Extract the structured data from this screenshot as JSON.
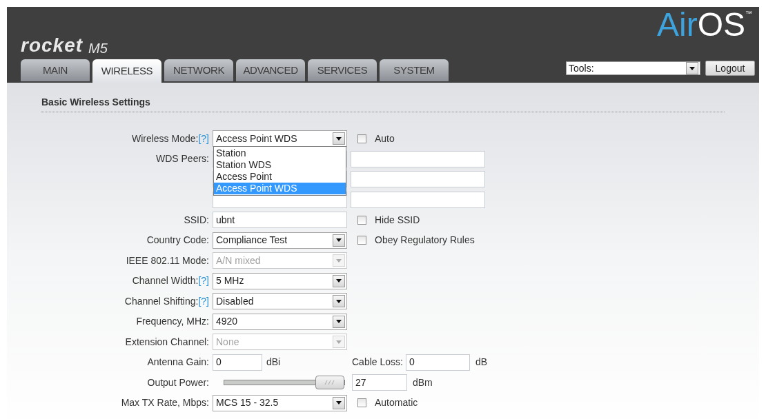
{
  "header": {
    "logo": "rocket",
    "model": "M5",
    "brand": "AirOS",
    "trademark": "™"
  },
  "tabs": [
    {
      "label": "MAIN",
      "selected": false
    },
    {
      "label": "WIRELESS",
      "selected": true
    },
    {
      "label": "NETWORK",
      "selected": false
    },
    {
      "label": "ADVANCED",
      "selected": false
    },
    {
      "label": "SERVICES",
      "selected": false
    },
    {
      "label": "SYSTEM",
      "selected": false
    }
  ],
  "tools": {
    "value": "Tools:"
  },
  "logout": "Logout",
  "section_title": "Basic Wireless Settings",
  "rows": [
    {
      "kind": "select",
      "label": "Wireless Mode:",
      "help": "[?]",
      "value": "Access Point WDS",
      "disabled": false,
      "expanded": true,
      "options": [
        {
          "label": "Station",
          "selected": false
        },
        {
          "label": "Station WDS",
          "selected": false
        },
        {
          "label": "Access Point",
          "selected": false
        },
        {
          "label": "Access Point WDS",
          "selected": true
        }
      ],
      "extra": {
        "kind": "checkbox",
        "label": "Auto",
        "checked": false
      }
    },
    {
      "kind": "peers",
      "label": "WDS Peers:"
    },
    {
      "kind": "text",
      "label": "SSID:",
      "value": "ubnt",
      "extra": {
        "kind": "checkbox",
        "label": "Hide SSID",
        "checked": false
      }
    },
    {
      "kind": "select",
      "label": "Country Code:",
      "value": "Compliance Test",
      "disabled": false,
      "extra": {
        "kind": "checkbox",
        "label": "Obey Regulatory Rules",
        "checked": false
      }
    },
    {
      "kind": "select",
      "label": "IEEE 802.11 Mode:",
      "value": "A/N mixed",
      "disabled": true
    },
    {
      "kind": "select",
      "label": "Channel Width:",
      "help": "[?]",
      "value": "5 MHz",
      "disabled": false
    },
    {
      "kind": "select",
      "label": "Channel Shifting:",
      "help": "[?]",
      "value": "Disabled",
      "disabled": false
    },
    {
      "kind": "select",
      "label": "Frequency, MHz:",
      "value": "4920",
      "disabled": false
    },
    {
      "kind": "select",
      "label": "Extension Channel:",
      "value": "None",
      "disabled": true
    },
    {
      "kind": "short",
      "label": "Antenna Gain:",
      "value": "0",
      "unit": "dBi",
      "extra": {
        "kind": "field",
        "label": "Cable Loss:",
        "value": "0",
        "unit": "dB"
      }
    },
    {
      "kind": "slider",
      "label": "Output Power:",
      "level": 1,
      "value": "27",
      "unit": "dBm"
    },
    {
      "kind": "select",
      "label": "Max TX Rate, Mbps:",
      "value": "MCS 15 - 32.5",
      "disabled": false,
      "extra": {
        "kind": "checkbox",
        "label": "Automatic",
        "checked": false
      }
    }
  ]
}
